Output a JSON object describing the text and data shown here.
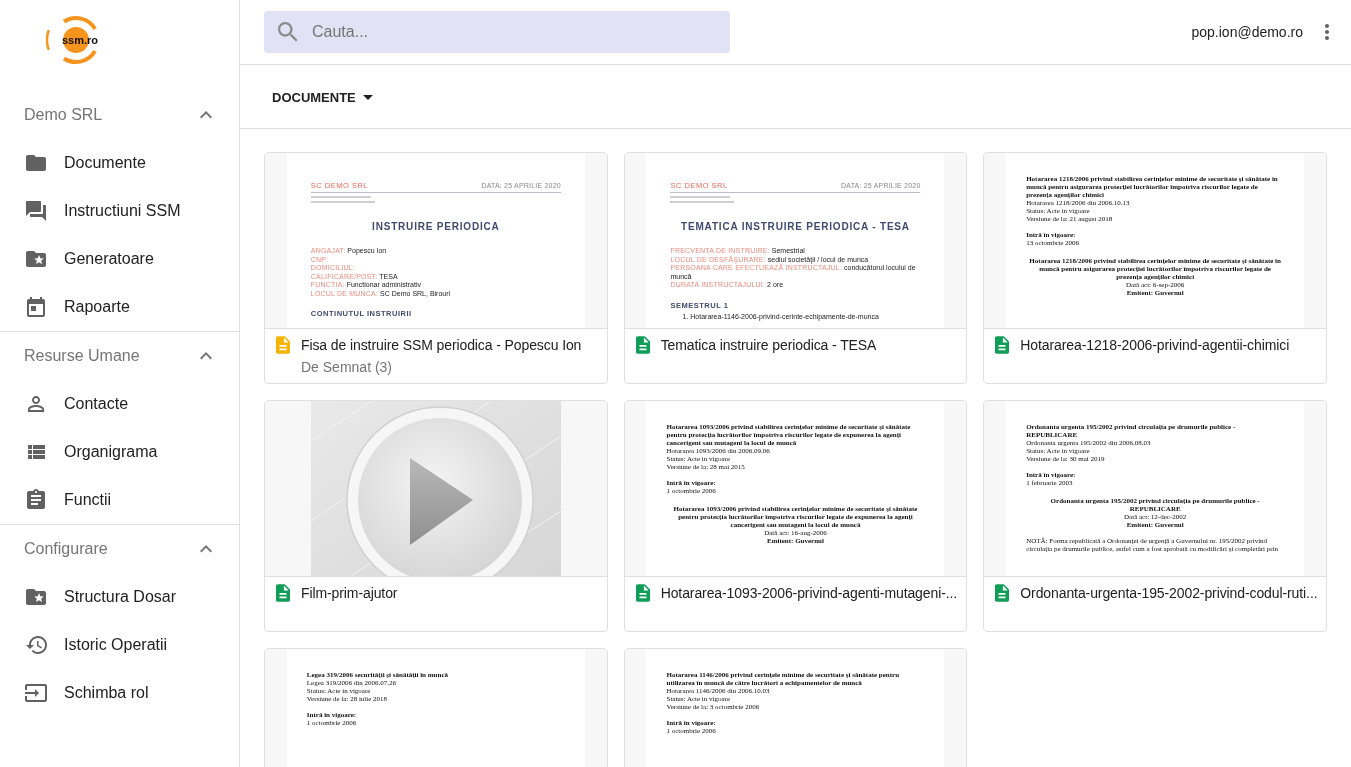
{
  "sidebar": {
    "logo": {
      "text": "ssm.ro"
    },
    "sections": [
      {
        "title": "Demo SRL",
        "expanded": true,
        "items": [
          {
            "label": "Documente",
            "selected": false
          },
          {
            "label": "Instructiuni SSM",
            "selected": false
          },
          {
            "label": "Generatoare",
            "selected": false
          },
          {
            "label": "Rapoarte",
            "selected": false
          }
        ]
      },
      {
        "title": "Resurse Umane",
        "expanded": true,
        "items": [
          {
            "label": "Contacte",
            "selected": false
          },
          {
            "label": "Organigrama",
            "selected": false
          },
          {
            "label": "Functii",
            "selected": false
          }
        ]
      },
      {
        "title": "Configurare",
        "expanded": true,
        "items": [
          {
            "label": "Structura Dosar",
            "selected": false
          },
          {
            "label": "Istoric Operatii",
            "selected": false
          },
          {
            "label": "Schimba rol",
            "selected": false
          }
        ]
      }
    ]
  },
  "topbar": {
    "search": {
      "placeholder": "Cauta..."
    },
    "user_email": "pop.ion@demo.ro"
  },
  "toolbar": {
    "view_menu": "DOCUMENTE"
  },
  "cards": [
    {
      "title": "Fisa de instruire SSM periodica - Popescu Ion",
      "subtitle": "De Semnat (3)",
      "color": "#f4b400",
      "preview": {
        "kind": "form",
        "company": "SC DEMO SRL",
        "date": "DATA: 25 APRILIE 2020",
        "title": "INSTRUIRE PERIODICA",
        "fields": [
          {
            "label": "ANGAJAT:",
            "value": "Popescu Ion"
          },
          {
            "label": "CNP:"
          },
          {
            "label": "DOMICILIUL:"
          },
          {
            "label": "CALIFICARE/POST:",
            "value": "TESA"
          },
          {
            "label": "FUNCTIA:",
            "value": "Functionar administrativ"
          },
          {
            "label": "LOCUL DE MUNCA:",
            "value": "SC Demo SRL, Birouri"
          }
        ],
        "section": "CONTINUTUL INSTRUIRII"
      }
    },
    {
      "title": "Tematica instruire periodica - TESA",
      "color": "#0f9d58",
      "preview": {
        "kind": "form",
        "company": "SC DEMO SRL",
        "date": "DATA: 25 APRILIE 2020",
        "title": "TEMATICA INSTRUIRE PERIODICA - TESA",
        "fields": [
          {
            "label": "FRECVENTA DE INSTRUIRE:",
            "value": "Semestrial"
          },
          {
            "label": "LOCUL DE DESFĂŞURARE:",
            "value": "sediul societăţii / locul de munca"
          },
          {
            "label": "PERSOANA CARE EFECTUEAZĂ INSTRUCTAJUL:",
            "value": "conducătorul locului de muncă"
          },
          {
            "label": "DURATA INSTRUCTAJULUI:",
            "value": "2 ore"
          }
        ],
        "section": "SEMESTRUL 1",
        "list": [
          "1. Hotararea-1146-2006-privind-cerinte-echipamente-de-munca"
        ]
      }
    },
    {
      "title": "Hotararea-1218-2006-privind-agentii-chimici",
      "color": "#0f9d58",
      "preview": {
        "kind": "law",
        "heading": "Hotararea 1218/2006 privind stabilirea cerinţelor minime de securitate şi sănătate în muncă pentru asigurarea protecţiei lucrătorilor împotriva riscurilor legate de prezenţa agenţilor chimici",
        "meta": [
          "Hotararea 1218/2006 din 2006.10.13",
          "Status: Acte in vigoare",
          "Versiune de la: 21 august 2018"
        ],
        "in_force": {
          "label": "Intră în vigoare:",
          "date": "13 octombrie 2006"
        },
        "center_title": "Hotararea 1218/2006 privind stabilirea cerinţelor minime de securitate şi sănătate în muncă pentru asigurarea protecţiei lucrătorilor împotriva riscurilor legate de prezenţa agenţilor chimici",
        "act_date": "Dată act: 6-sep-2006",
        "issuer": "Emitent: Guvernul"
      }
    },
    {
      "title": "Film-prim-ajutor",
      "color": "#0f9d58",
      "preview": {
        "kind": "video"
      }
    },
    {
      "title": "Hotararea-1093-2006-privind-agenti-mutageni-...",
      "color": "#0f9d58",
      "preview": {
        "kind": "law",
        "heading": "Hotararea 1093/2006 privind stabilirea cerinţelor minime de securitate şi sănătate pentru protecţia lucrătorilor împotriva riscurilor legate de expunerea la agenţi cancerigeni sau mutageni la locul de muncă",
        "meta": [
          "Hotararea 1093/2006 din 2006.09.06",
          "Status: Acte in vigoare",
          "Versiune de la: 28 mai 2015"
        ],
        "in_force": {
          "label": "Intră în vigoare:",
          "date": "1 octombrie 2006"
        },
        "center_title": "Hotararea 1093/2006 privind stabilirea cerinţelor minime de securitate şi sănătate pentru protecţia lucrătorilor împotriva riscurilor legate de expunerea la agenţi cancerigeni sau mutageni la locul de muncă",
        "act_date": "Dată act: 16-aug-2006",
        "issuer": "Emitent: Guvernul"
      }
    },
    {
      "title": "Ordonanta-urgenta-195-2002-privind-codul-ruti...",
      "color": "#0f9d58",
      "preview": {
        "kind": "law",
        "heading": "Ordonanta urgenta 195/2002 privind circulaţia pe drumurile publice - REPUBLICARE",
        "meta": [
          "Ordonanta urgenta 195/2002 din 2006.08.03",
          "Status: Acte in vigoare",
          "Versiune de la: 30 mai 2019"
        ],
        "in_force": {
          "label": "Intră în vigoare:",
          "date": "1 februarie 2003"
        },
        "center_title": "Ordonanta urgenta 195/2002 privind circulaţia pe drumurile publice - REPUBLICARE",
        "act_date": "Dată act: 12-dec-2002",
        "issuer": "Emitent: Guvernul",
        "note": "NOTĂ: Forma republicată a Ordonanţei de urgenţă a Guvernului nr. 195/2002 privind circulaţia pe drumurile publice, astfel cum a fost aprobată cu modificări şi completări prin"
      }
    },
    {
      "preview": {
        "kind": "law",
        "heading": "Legea 319/2006 securităţii şi sănătăţii în muncă",
        "meta": [
          "Legea 319/2006 din 2006.07.26",
          "Status: Acte in vigoare",
          "Versiune de la: 28 iulie 2018"
        ],
        "in_force": {
          "label": "Intră în vigoare:",
          "date": "1 octombrie 2006"
        }
      }
    },
    {
      "preview": {
        "kind": "law",
        "heading": "Hotararea 1146/2006 privind cerinţele minime de securitate şi sănătate pentru utilizarea în muncă de către lucrători a echipamentelor de muncă",
        "meta": [
          "Hotararea 1146/2006 din 2006.10.03",
          "Status: Acte in vigoare",
          "Versiune de la: 3 octombrie 2006"
        ],
        "in_force": {
          "label": "Intră în vigoare:",
          "date": "1 octombrie 2006"
        }
      }
    }
  ]
}
